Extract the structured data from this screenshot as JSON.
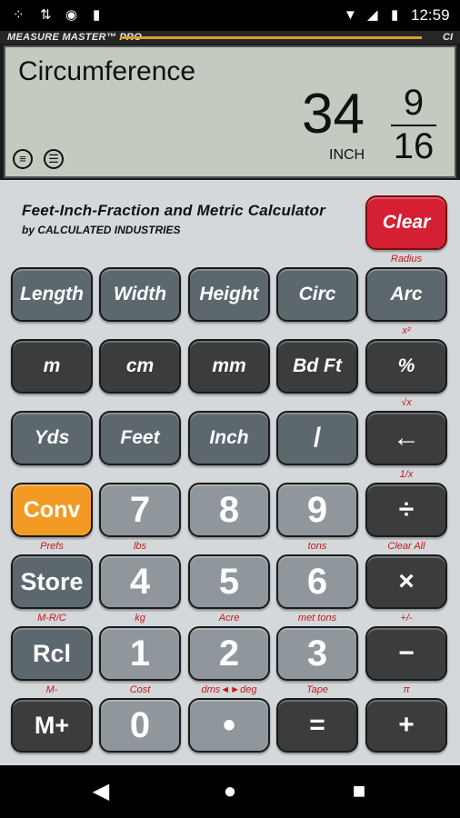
{
  "status_bar": {
    "time": "12:59",
    "icons": [
      "network-icon",
      "sync-icon",
      "record-icon",
      "sd-card-icon",
      "wifi-icon",
      "signal-icon",
      "battery-icon"
    ]
  },
  "app": {
    "brand": "MEASURE MASTER™ PRO",
    "ci_logo": "CI"
  },
  "display": {
    "label": "Circumference",
    "whole": "34",
    "numerator": "9",
    "denominator": "16",
    "unit": "INCH",
    "icons": [
      "list-icon",
      "tape-icon"
    ]
  },
  "header": {
    "title": "Feet-Inch-Fraction and Metric Calculator",
    "subtitle": "by CALCULATED INDUSTRIES"
  },
  "clear_key": {
    "label": "Clear",
    "secondary": "Radius"
  },
  "rows": [
    [
      {
        "label": "Length",
        "secondary": ""
      },
      {
        "label": "Width",
        "secondary": ""
      },
      {
        "label": "Height",
        "secondary": ""
      },
      {
        "label": "Circ",
        "secondary": ""
      },
      {
        "label": "Arc",
        "secondary": "x²"
      }
    ],
    [
      {
        "label": "m",
        "secondary": ""
      },
      {
        "label": "cm",
        "secondary": ""
      },
      {
        "label": "mm",
        "secondary": ""
      },
      {
        "label": "Bd Ft",
        "secondary": ""
      },
      {
        "label": "%",
        "secondary": "√x"
      }
    ],
    [
      {
        "label": "Yds",
        "secondary": ""
      },
      {
        "label": "Feet",
        "secondary": ""
      },
      {
        "label": "Inch",
        "secondary": ""
      },
      {
        "label": "/",
        "secondary": ""
      },
      {
        "label": "←",
        "secondary": "1/x"
      }
    ],
    [
      {
        "label": "Conv",
        "secondary": "Prefs"
      },
      {
        "label": "7",
        "secondary": "lbs"
      },
      {
        "label": "8",
        "secondary": ""
      },
      {
        "label": "9",
        "secondary": "tons"
      },
      {
        "label": "÷",
        "secondary": "Clear All"
      }
    ],
    [
      {
        "label": "Store",
        "secondary": "M-R/C"
      },
      {
        "label": "4",
        "secondary": "kg"
      },
      {
        "label": "5",
        "secondary": "Acre"
      },
      {
        "label": "6",
        "secondary": "met tons"
      },
      {
        "label": "×",
        "secondary": "+/-"
      }
    ],
    [
      {
        "label": "Rcl",
        "secondary": "M-"
      },
      {
        "label": "1",
        "secondary": "Cost"
      },
      {
        "label": "2",
        "secondary": "dms◄►deg"
      },
      {
        "label": "3",
        "secondary": "Tape"
      },
      {
        "label": "−",
        "secondary": "π"
      }
    ],
    [
      {
        "label": "M+",
        "secondary": ""
      },
      {
        "label": "0",
        "secondary": ""
      },
      {
        "label": "•",
        "secondary": ""
      },
      {
        "label": "=",
        "secondary": ""
      },
      {
        "label": "+",
        "secondary": ""
      }
    ]
  ],
  "nav": {
    "back": "◀",
    "home": "●",
    "recents": "■"
  },
  "colors": {
    "display_bg": "#c3cbc1",
    "keypad_bg": "#d4d8da",
    "clear_red": "#d42032",
    "conv_orange": "#f39a25",
    "secondary_red": "#c41a1a"
  }
}
